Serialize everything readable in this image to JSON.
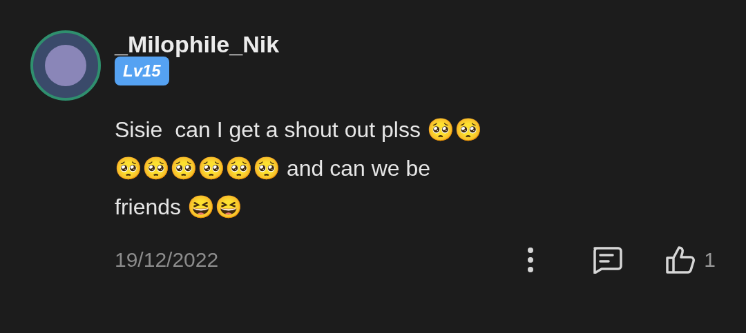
{
  "comment": {
    "author": "_Milophile_Nik",
    "level_badge": "Lv15",
    "text": "Sisie  can I get a shout out plss 🥺🥺🥺🥺🥺🥺🥺🥺 and can we be friends 😆😆",
    "date": "19/12/2022",
    "like_count": "1"
  }
}
